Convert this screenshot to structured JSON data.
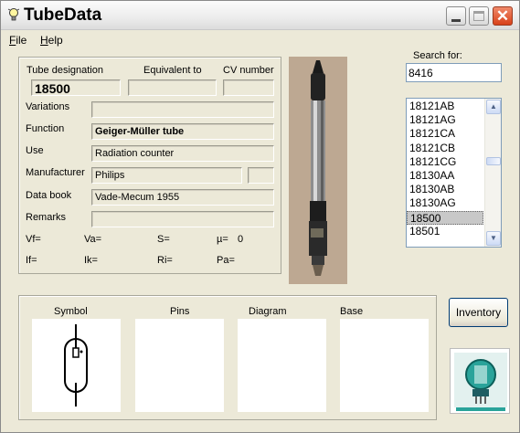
{
  "window": {
    "title": "TubeData"
  },
  "menu": {
    "file": "File",
    "file_mnemonic": "F",
    "file_rest": "ile",
    "help_mnemonic": "H",
    "help_rest": "elp"
  },
  "labels": {
    "tube_designation": "Tube designation",
    "equivalent_to": "Equivalent to",
    "cv_number": "CV number",
    "variations": "Variations",
    "function": "Function",
    "use": "Use",
    "manufacturer": "Manufacturer",
    "data_book": "Data book",
    "remarks": "Remarks",
    "vf": "Vf=",
    "va": "Va=",
    "s": "S=",
    "mu": "µ=",
    "if": "If=",
    "ik": "Ik=",
    "ri": "Ri=",
    "pa": "Pa="
  },
  "values": {
    "tube_designation": "18500",
    "equivalent_to": "",
    "cv_number": "",
    "variations": "",
    "function": "Geiger-Müller tube",
    "use": "Radiation counter",
    "manufacturer": "Philips",
    "manufacturer_extra": "",
    "data_book": "Vade-Mecum 1955",
    "remarks": "",
    "mu": "0"
  },
  "search": {
    "label": "Search for:",
    "value": "8416"
  },
  "tube_list": {
    "items": [
      "18121AB",
      "18121AG",
      "18121CA",
      "18121CB",
      "18121CG",
      "18130AA",
      "18130AB",
      "18130AG",
      "18500",
      "18501"
    ],
    "selected": "18500"
  },
  "panels": {
    "symbol": "Symbol",
    "pins": "Pins",
    "diagram": "Diagram",
    "base": "Base"
  },
  "buttons": {
    "inventory": "Inventory"
  },
  "icons": {
    "app": "lightbulb-icon",
    "scroll_up": "arrow-up-icon",
    "scroll_down": "arrow-down-icon"
  }
}
